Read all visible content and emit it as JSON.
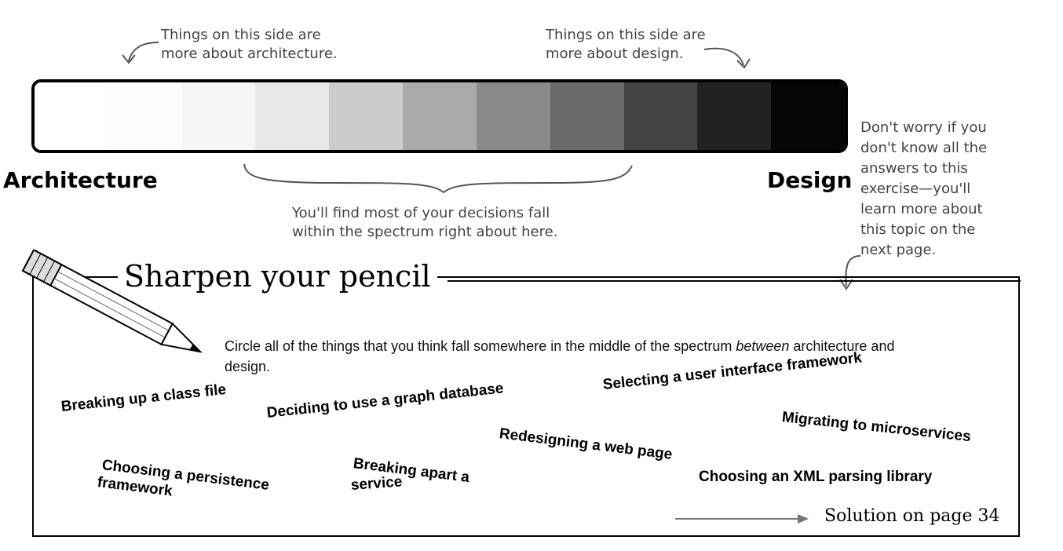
{
  "annotations": {
    "arch_side": [
      "Things on this side are",
      "more about architecture."
    ],
    "design_side": [
      "Things on this side are",
      "more about design."
    ],
    "bracket_note": [
      "You'll find most of your decisions fall",
      "within the spectrum right about here."
    ],
    "worry_note": [
      "Don't worry if you",
      "don't know all the",
      "answers to this",
      "exercise—you'll",
      "learn more about",
      "this topic on the",
      "next page."
    ]
  },
  "spectrum": {
    "left_label": "Architecture",
    "right_label": "Design",
    "shades": [
      "#ffffff",
      "#fdfcfc",
      "#f6f6f6",
      "#e8e8e8",
      "#cccccc",
      "#aaaaaa",
      "#8a8a8a",
      "#6a6a6a",
      "#444444",
      "#222222",
      "#050505"
    ]
  },
  "exercise": {
    "title": "Sharpen your pencil",
    "instruction_pre": "Circle all of the things that you think fall somewhere in the middle of the spectrum ",
    "instruction_em": "between",
    "instruction_post": " architecture and design.",
    "options": [
      "Breaking up a class file",
      "Deciding to use a graph database",
      "Selecting a user interface framework",
      "Migrating to microservices",
      "Redesigning a web page",
      "Choosing a persistence",
      "framework",
      "Breaking apart a",
      "service",
      "Choosing an XML parsing library"
    ],
    "solution": "Solution on page 34"
  }
}
